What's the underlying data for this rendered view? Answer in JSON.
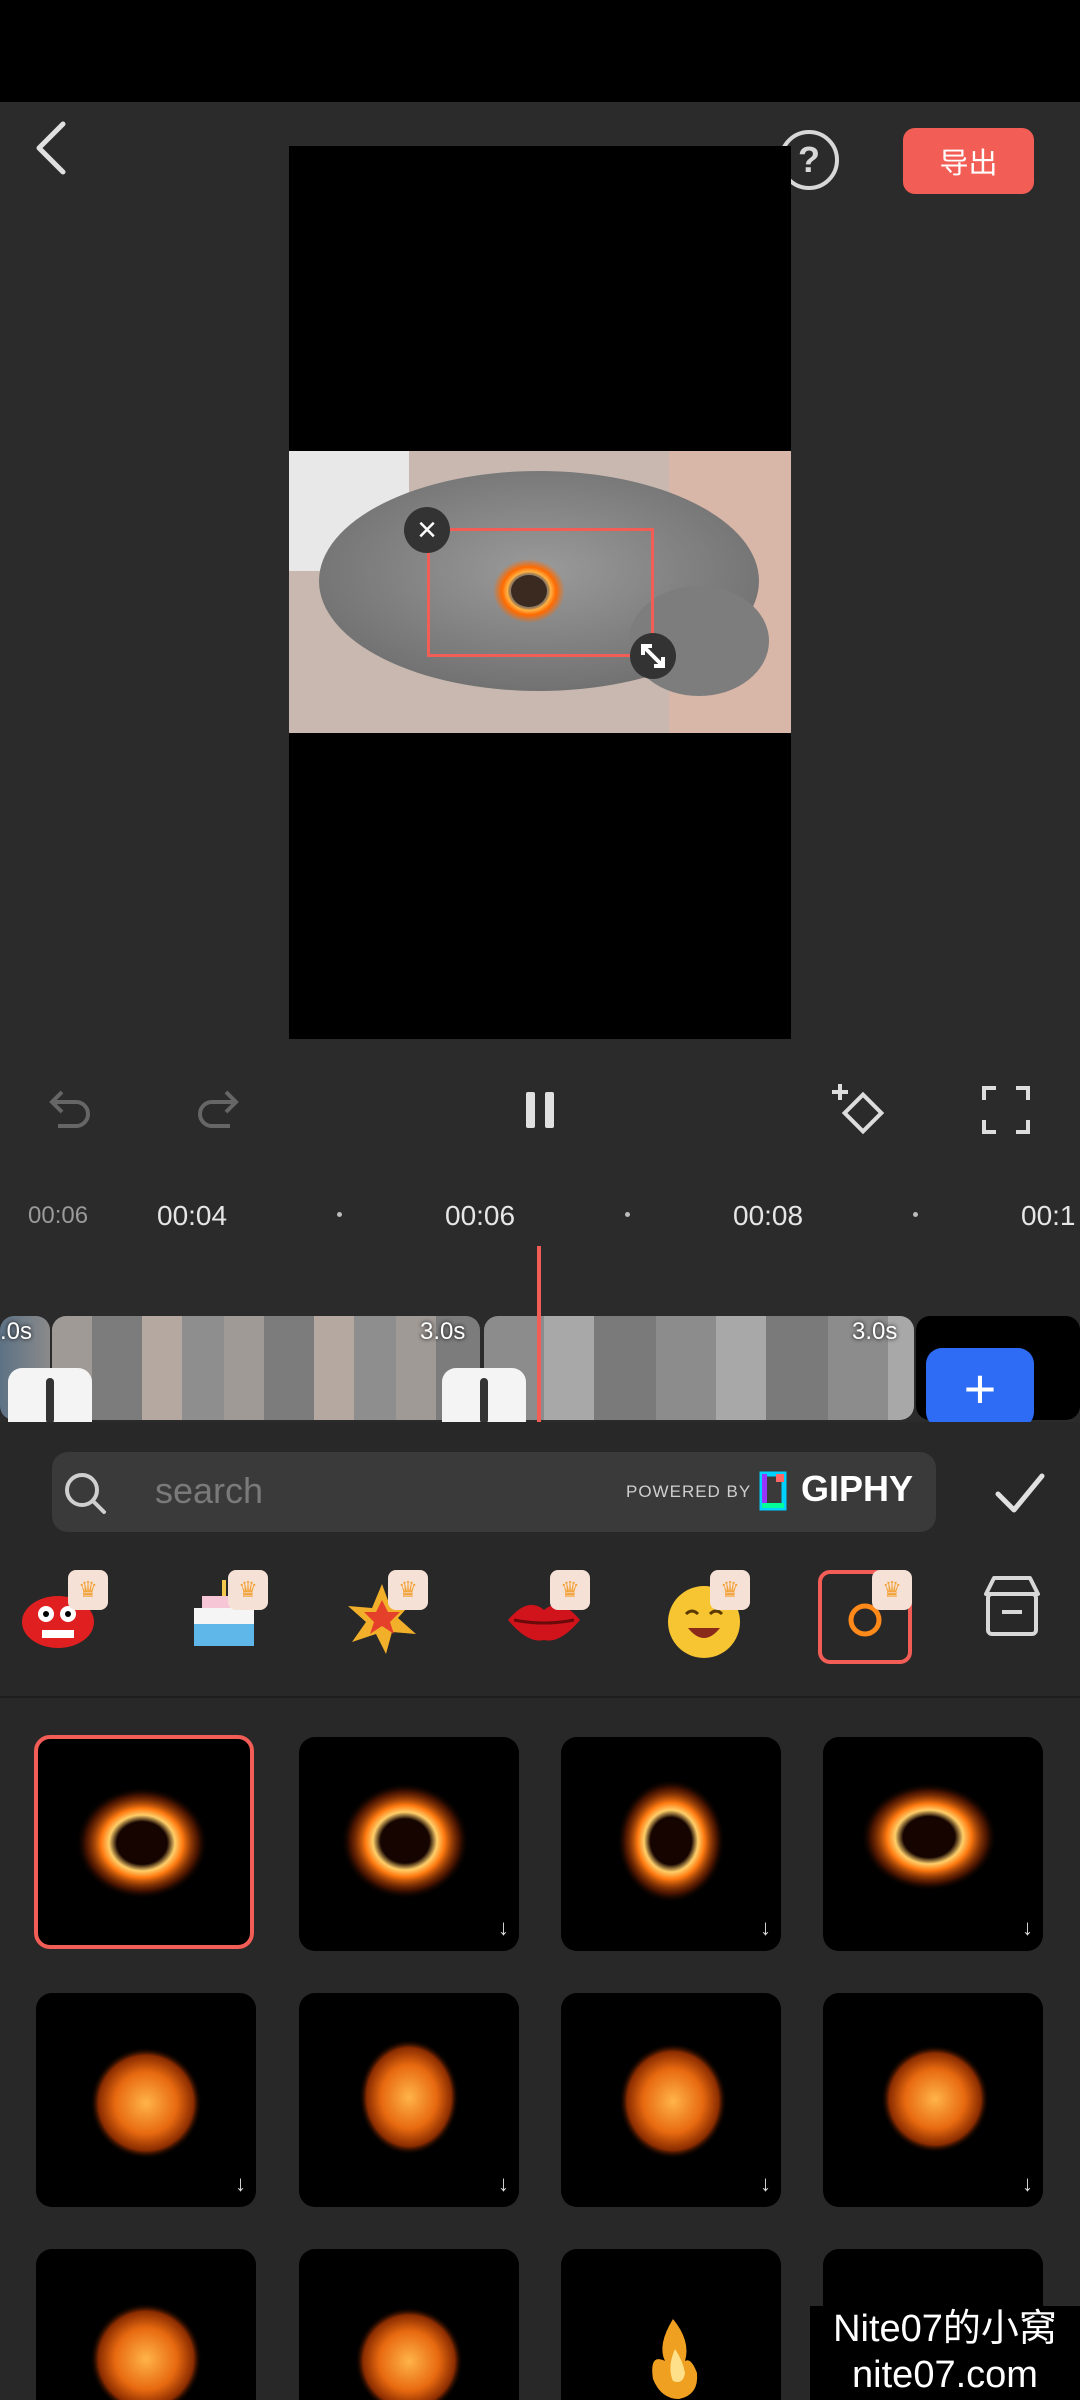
{
  "header": {
    "export_label": "导出",
    "help_label": "?"
  },
  "controls": {
    "undo": "undo-icon",
    "redo": "redo-icon",
    "pause": "pause-icon",
    "keyframe": "keyframe-add-icon",
    "fullscreen": "fullscreen-icon"
  },
  "timeline": {
    "current_time": "00:06",
    "ticks": [
      "00:04",
      "00:06",
      "00:08",
      "00:1"
    ],
    "clips": [
      {
        "duration": ".0s"
      },
      {
        "duration": "3.0s"
      },
      {
        "duration": "3.0s"
      }
    ],
    "add_label": "+"
  },
  "search": {
    "placeholder": "search",
    "powered_by": "POWERED BY",
    "brand": "GIPHY"
  },
  "categories": [
    {
      "name": "monster",
      "premium": true
    },
    {
      "name": "birthday-cake",
      "premium": true
    },
    {
      "name": "boom",
      "premium": true
    },
    {
      "name": "lips",
      "premium": true
    },
    {
      "name": "emoji-face",
      "premium": true
    },
    {
      "name": "fire-ring",
      "premium": true,
      "selected": true
    },
    {
      "name": "store",
      "premium": false
    }
  ],
  "stickers": {
    "row1": [
      "fire-ring-1",
      "fire-ring-2",
      "fire-ring-3",
      "fire-ring-4"
    ],
    "row2": [
      "fire-ball-1",
      "fire-ball-2",
      "fire-ball-3",
      "fire-ball-4"
    ],
    "row3": [
      "fire-ball-5",
      "fire-ball-6",
      "fire-flame",
      "fire-misc"
    ]
  },
  "watermark": {
    "line1": "Nite07的小窝",
    "line2": "nite07.com"
  },
  "colors": {
    "accent": "#f25d55",
    "add_button": "#2e6cf6",
    "background": "#2b2b2b"
  }
}
